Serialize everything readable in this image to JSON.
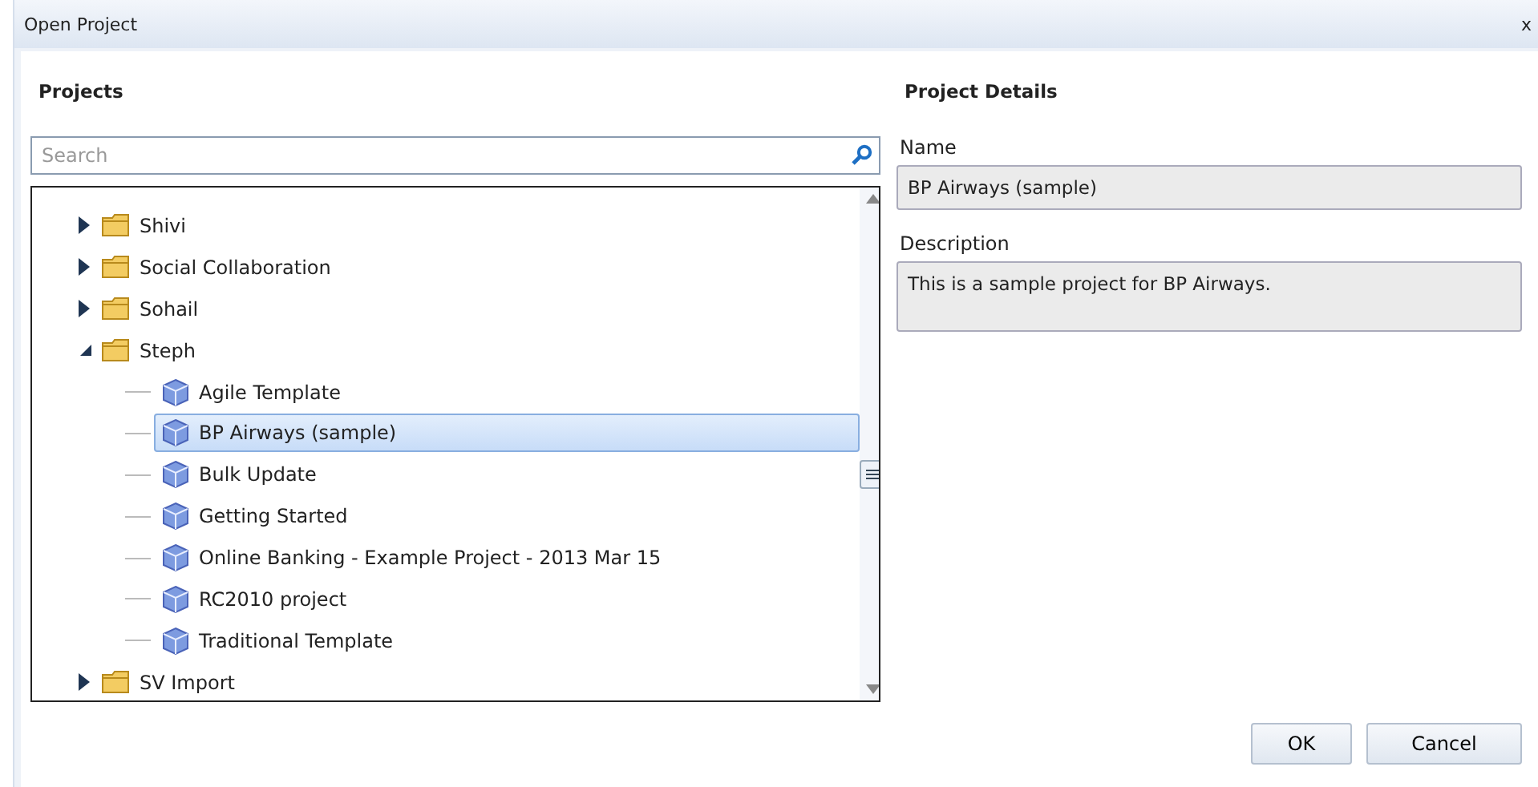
{
  "window": {
    "title": "Open Project",
    "close": "x"
  },
  "projects": {
    "heading": "Projects",
    "search": {
      "placeholder": "Search"
    },
    "tree": [
      {
        "label": "Shivi",
        "kind": "folder",
        "expanded": false,
        "selected": false
      },
      {
        "label": "Social Collaboration",
        "kind": "folder",
        "expanded": false,
        "selected": false
      },
      {
        "label": "Sohail",
        "kind": "folder",
        "expanded": false,
        "selected": false
      },
      {
        "label": "Steph",
        "kind": "folder",
        "expanded": true,
        "selected": false,
        "children": [
          {
            "label": "Agile Template",
            "kind": "project",
            "selected": false
          },
          {
            "label": "BP Airways (sample)",
            "kind": "project",
            "selected": true
          },
          {
            "label": "Bulk Update",
            "kind": "project",
            "selected": false
          },
          {
            "label": "Getting Started",
            "kind": "project",
            "selected": false
          },
          {
            "label": "Online Banking - Example Project - 2013 Mar 15",
            "kind": "project",
            "selected": false
          },
          {
            "label": "RC2010 project",
            "kind": "project",
            "selected": false
          },
          {
            "label": "Traditional Template",
            "kind": "project",
            "selected": false
          }
        ]
      },
      {
        "label": "SV Import",
        "kind": "folder",
        "expanded": false,
        "selected": false
      }
    ]
  },
  "details": {
    "heading": "Project Details",
    "name_label": "Name",
    "name": "BP Airways (sample)",
    "description_label": "Description",
    "description": "This is a sample project for BP Airways."
  },
  "buttons": [
    "OK",
    "Cancel"
  ]
}
